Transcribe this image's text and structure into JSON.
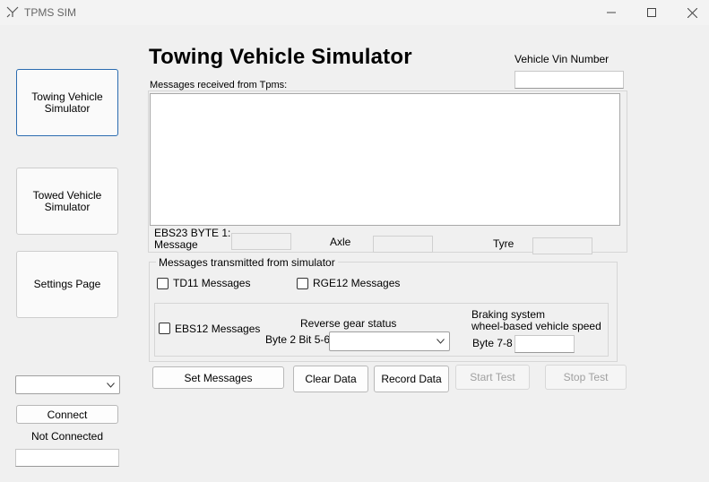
{
  "window": {
    "title": "TPMS SIM"
  },
  "nav": {
    "towing": "Towing Vehicle Simulator",
    "towed": "Towed Vehicle Simulator",
    "settings": "Settings Page"
  },
  "connection": {
    "port_value": "",
    "connect_label": "Connect",
    "status": "Not Connected",
    "status_field": ""
  },
  "main": {
    "heading": "Towing Vehicle Simulator",
    "vin_label": "Vehicle Vin Number",
    "vin_value": "",
    "received_label": "Messages received from Tpms:",
    "received_text": "",
    "ebs23_label_1": "EBS23 BYTE 1:",
    "ebs23_label_2": "Message",
    "ebs23_value": "",
    "axle_label": "Axle",
    "axle_value": "",
    "tyre_label": "Tyre",
    "tyre_value": ""
  },
  "transmitted": {
    "group_label": "Messages transmitted from simulator",
    "td11_label": "TD11 Messages",
    "rge12_label": "RGE12 Messages",
    "ebs12_label": "EBS12 Messages",
    "reverse_label": "Reverse gear status",
    "byte_label": "Byte 2 Bit 5-6",
    "reverse_value": "",
    "braking_label_1": "Braking system",
    "braking_label_2": "wheel-based vehicle speed",
    "byte78_label": "Byte 7-8",
    "speed_value": ""
  },
  "buttons": {
    "set_messages": "Set Messages",
    "clear_data": "Clear Data",
    "record_data": "Record Data",
    "start_test": "Start Test",
    "stop_test": "Stop Test"
  },
  "icons": {
    "app": "app-logo-icon",
    "minimize": "minimize-icon",
    "maximize": "maximize-icon",
    "close": "close-icon",
    "dropdown": "chevron-down-icon"
  }
}
